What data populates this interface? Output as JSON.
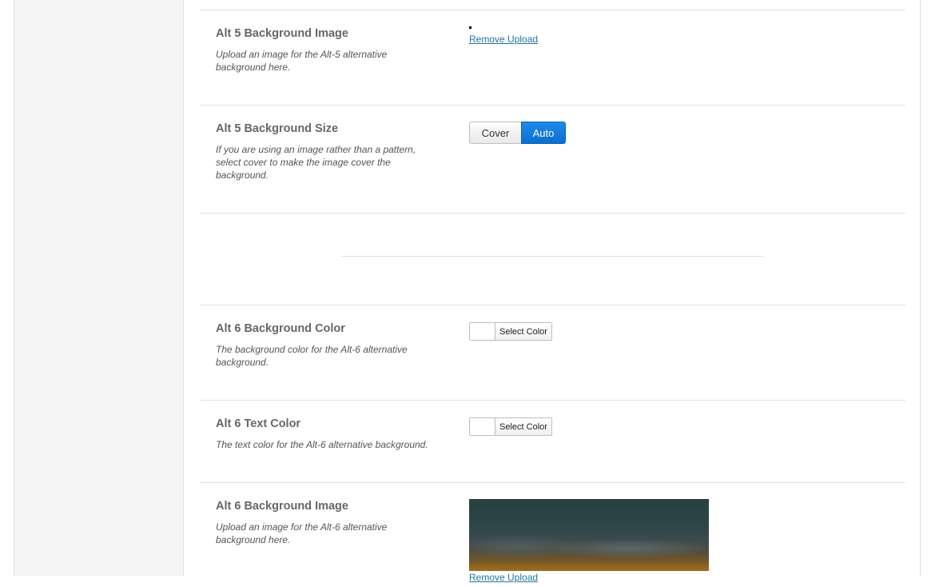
{
  "rows": {
    "alt5_image": {
      "title": "Alt 5 Background Image",
      "desc": "Upload an image for the Alt-5 alternative background here.",
      "remove_link": "Remove Upload"
    },
    "alt5_size": {
      "title": "Alt 5 Background Size",
      "desc": "If you are using an image rather than a pattern, select cover to make the image cover the background.",
      "options": [
        "Cover",
        "Auto"
      ],
      "selected": "Auto"
    },
    "alt6_bg_color": {
      "title": "Alt 6 Background Color",
      "desc": "The background color for the Alt-6 alternative background.",
      "button_label": "Select Color"
    },
    "alt6_text_color": {
      "title": "Alt 6 Text Color",
      "desc": "The text color for the Alt-6 alternative background.",
      "button_label": "Select Color"
    },
    "alt6_image": {
      "title": "Alt 6 Background Image",
      "desc": "Upload an image for the Alt-6 alternative background here.",
      "remove_link": "Remove Upload"
    }
  },
  "colors": {
    "accent_blue": "#0b6fcf",
    "link": "#21759b"
  }
}
